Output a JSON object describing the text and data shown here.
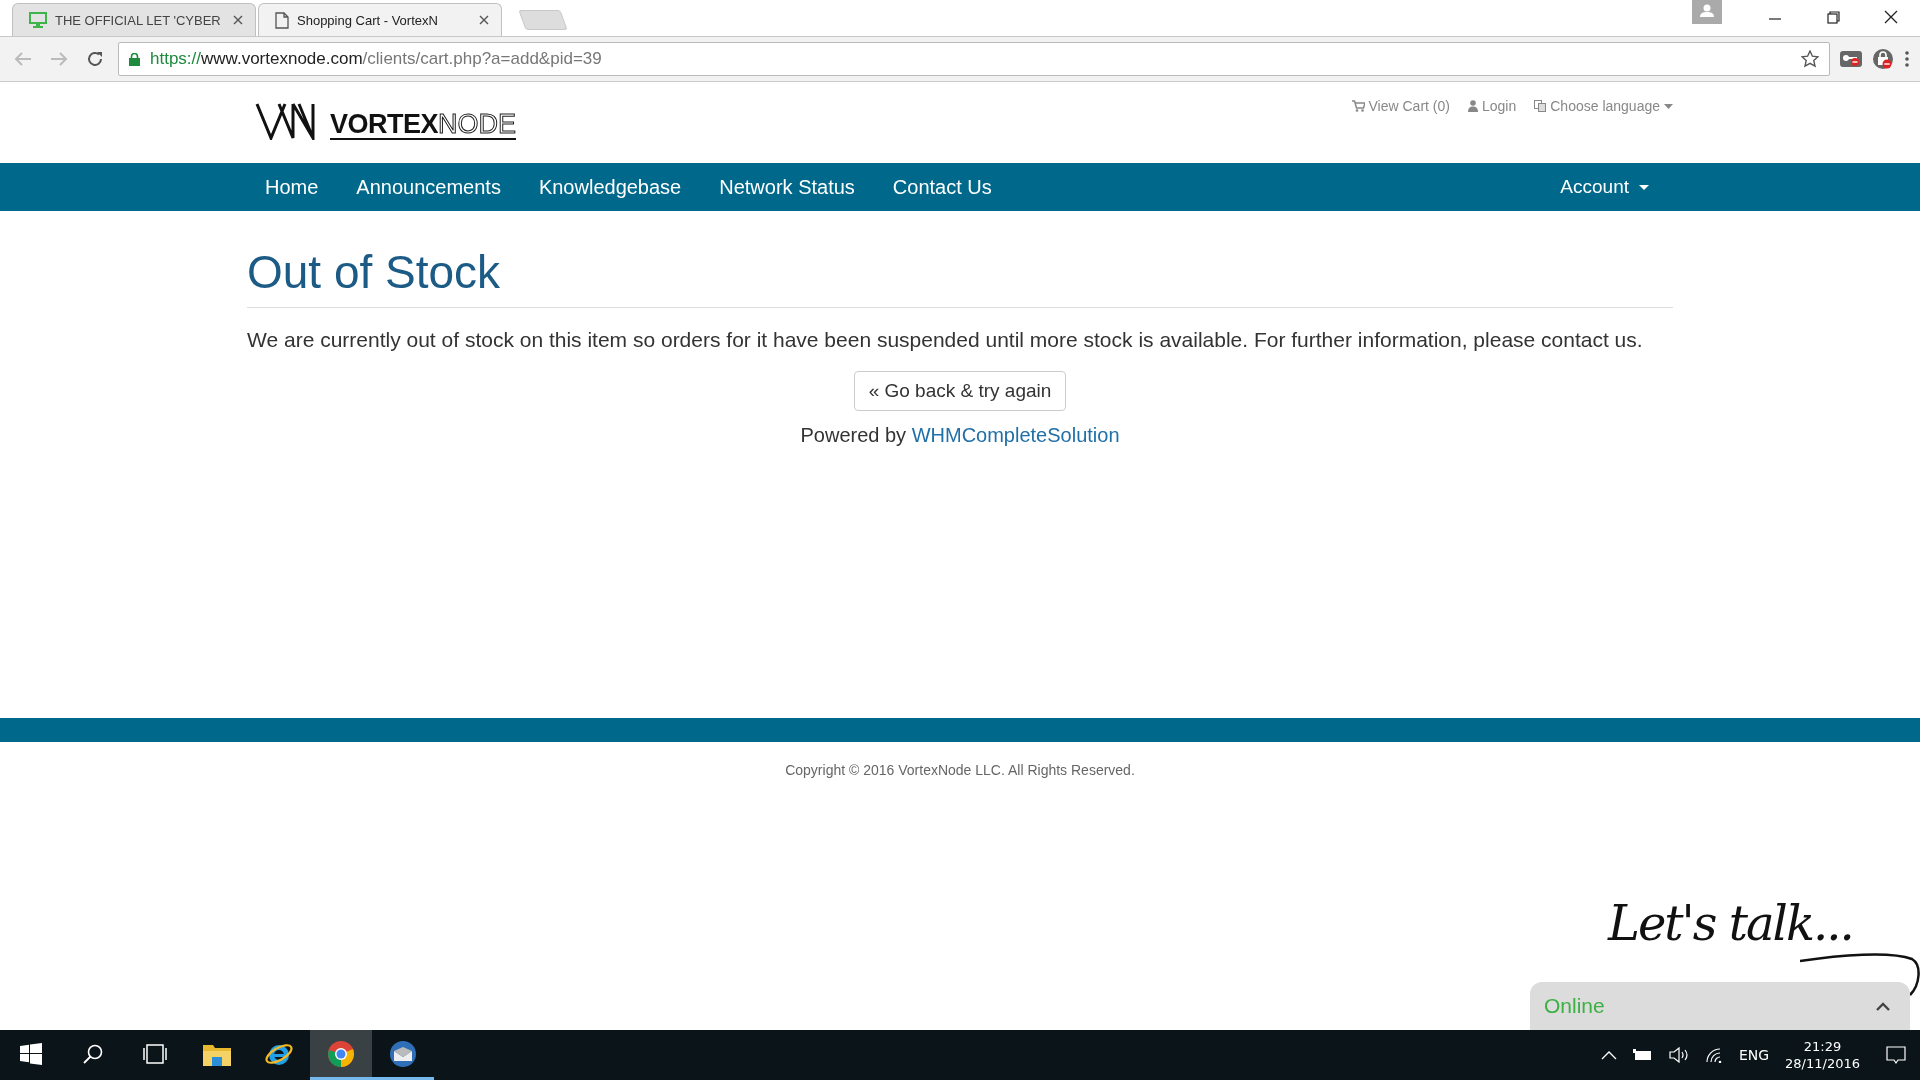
{
  "browser": {
    "tabs": [
      {
        "title": "THE OFFICIAL LET 'CYBER",
        "kind": "monitor",
        "selected": false
      },
      {
        "title": "Shopping Cart - VortexN",
        "kind": "document",
        "selected": true
      }
    ],
    "url": {
      "scheme": "https://",
      "host": "www.vortexnode.com",
      "path": "/clients/cart.php?a=add&pid=39"
    }
  },
  "header": {
    "logo": {
      "bold": "VORTEX",
      "light": "NODE"
    },
    "links": [
      {
        "label": "View Cart (0)",
        "kind": "cart"
      },
      {
        "label": "Login",
        "kind": "user"
      },
      {
        "label": "Choose language",
        "kind": "language"
      }
    ]
  },
  "nav": {
    "items": [
      "Home",
      "Announcements",
      "Knowledgebase",
      "Network Status",
      "Contact Us"
    ],
    "account": "Account"
  },
  "content": {
    "title": "Out of Stock",
    "message": "We are currently out of stock on this item so orders for it have been suspended until more stock is available. For further information, please contact us.",
    "button": "« Go back & try again",
    "powered_by": "Powered by",
    "powered_link": "WHMCompleteSolution"
  },
  "footer": {
    "copyright": "Copyright © 2016 VortexNode LLC. All Rights Reserved."
  },
  "chat": {
    "tagline": "Let's talk...",
    "status": "Online"
  },
  "taskbar": {
    "apps": [
      {
        "kind": "start",
        "running": false,
        "selected": false
      },
      {
        "kind": "search",
        "running": false,
        "selected": false
      },
      {
        "kind": "taskview",
        "running": false,
        "selected": false
      },
      {
        "kind": "explorer",
        "running": false,
        "selected": false
      },
      {
        "kind": "ie",
        "running": false,
        "selected": false
      },
      {
        "kind": "chrome",
        "running": true,
        "selected": true
      },
      {
        "kind": "mail",
        "running": true,
        "selected": false
      }
    ],
    "language": "ENG",
    "time": "21:29",
    "date": "28/11/2016"
  }
}
